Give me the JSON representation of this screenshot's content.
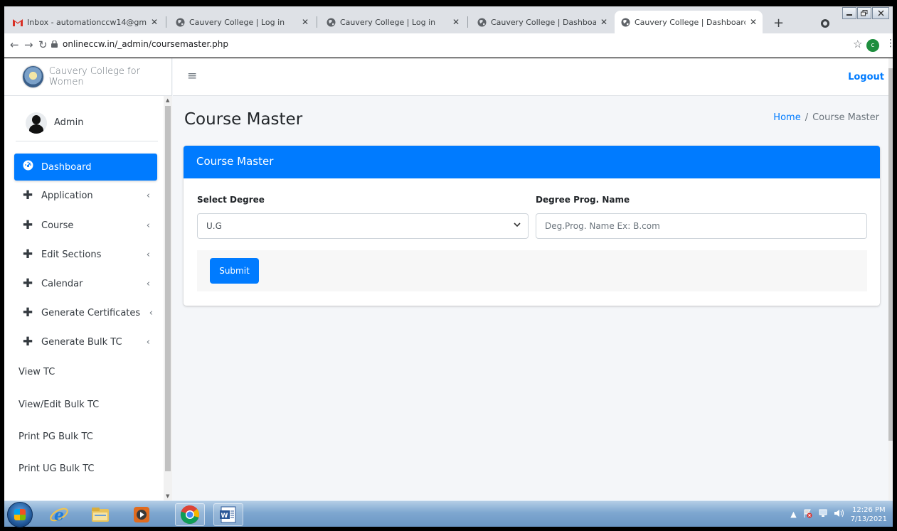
{
  "browser": {
    "tabs": [
      {
        "label": "Inbox - automationccw14@gm",
        "icon": "gmail-icon",
        "active": false
      },
      {
        "label": "Cauvery College | Log in",
        "icon": "globe-icon",
        "active": false
      },
      {
        "label": "Cauvery College | Log in",
        "icon": "globe-icon",
        "active": false
      },
      {
        "label": "Cauvery College | Dashboard",
        "icon": "globe-icon",
        "active": false
      },
      {
        "label": "Cauvery College | Dashboard",
        "icon": "globe-icon",
        "active": true
      }
    ],
    "close_glyph": "✕",
    "new_tab_glyph": "+",
    "url": "onlineccw.in/_admin/coursemaster.php",
    "profile_initial": "c"
  },
  "sidebar": {
    "brand": "Cauvery College for Women",
    "user": "Admin",
    "items": [
      {
        "label": "Dashboard",
        "icon": "dashboard-icon",
        "active": true,
        "expandable": false
      },
      {
        "label": "Application",
        "icon": "plus-icon",
        "active": false,
        "expandable": true
      },
      {
        "label": "Course",
        "icon": "plus-icon",
        "active": false,
        "expandable": true
      },
      {
        "label": "Edit Sections",
        "icon": "plus-icon",
        "active": false,
        "expandable": true
      },
      {
        "label": "Calendar",
        "icon": "plus-icon",
        "active": false,
        "expandable": true
      },
      {
        "label": "Generate Certificates",
        "icon": "plus-icon",
        "active": false,
        "expandable": true
      },
      {
        "label": "Generate Bulk TC",
        "icon": "plus-icon",
        "active": false,
        "expandable": true
      },
      {
        "label": "View TC",
        "icon": "",
        "active": false,
        "expandable": false
      },
      {
        "label": "View/Edit Bulk TC",
        "icon": "",
        "active": false,
        "expandable": false
      },
      {
        "label": "Print PG Bulk TC",
        "icon": "",
        "active": false,
        "expandable": false
      },
      {
        "label": "Print UG Bulk TC",
        "icon": "",
        "active": false,
        "expandable": false
      }
    ]
  },
  "topnav": {
    "menu_glyph": "≡",
    "logout": "Logout"
  },
  "content": {
    "title": "Course Master",
    "breadcrumb": {
      "home": "Home",
      "separator": "/",
      "current": "Course Master"
    },
    "card": {
      "title": "Course Master",
      "select_degree_label": "Select Degree",
      "select_degree_value": "U.G",
      "prog_name_label": "Degree Prog. Name",
      "prog_name_placeholder": "Deg.Prog. Name Ex: B.com",
      "submit": "Submit"
    }
  },
  "taskbar": {
    "apps": [
      "ie-icon",
      "file-explorer-icon",
      "media-player-icon",
      "chrome-icon",
      "word-icon"
    ],
    "time": "12:26 PM",
    "date": "7/13/2021"
  },
  "colors": {
    "primary": "#007bff",
    "sidebar_bg": "#ffffff",
    "content_bg": "#f4f6f9"
  }
}
